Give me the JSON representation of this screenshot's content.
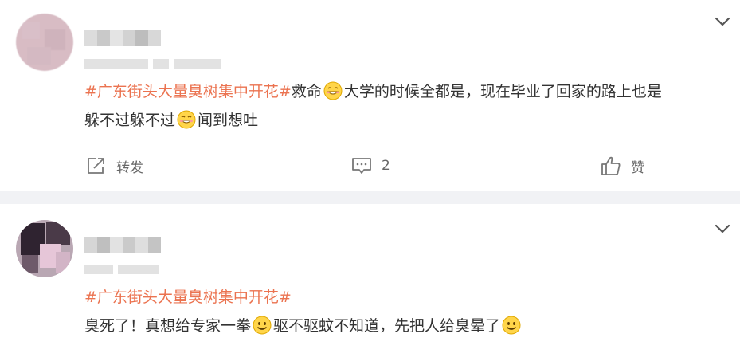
{
  "posts": [
    {
      "hashtag": "#广东街头大量臭树集中开花#",
      "line1_a": "救命",
      "line1_b": "大学的时候全都是，现在毕业了回家的路上也是",
      "line2_a": "躲不过躲不过",
      "line2_b": "闻到想吐",
      "emojis": [
        "grin-emoji",
        "grin-emoji"
      ],
      "repost_label": "转发",
      "comment_count": "2",
      "like_label": "赞"
    },
    {
      "hashtag": "#广东街头大量臭树集中开花#",
      "line2_a": "臭死了！真想给专家一拳",
      "line2_b": "驱不驱蚊不知道，先把人给臭晕了",
      "emojis": [
        "smile-emoji",
        "smile-emoji"
      ]
    }
  ],
  "colors": {
    "hashtag": "#eb7350",
    "separator": "#f1f2f5",
    "text": "#333333",
    "muted": "#666666"
  }
}
